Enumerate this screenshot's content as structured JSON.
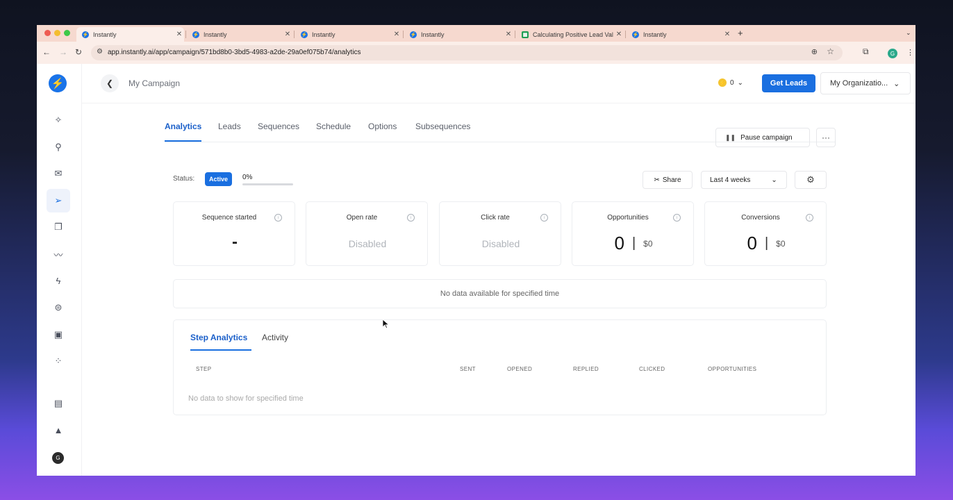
{
  "browser": {
    "tabs": [
      {
        "title": "Instantly",
        "favicon": "instantly-icon",
        "active": true
      },
      {
        "title": "Instantly",
        "favicon": "instantly-icon",
        "active": false
      },
      {
        "title": "Instantly",
        "favicon": "instantly-icon",
        "active": false
      },
      {
        "title": "Instantly",
        "favicon": "instantly-icon",
        "active": false
      },
      {
        "title": "Calculating Positive Lead Val",
        "favicon": "sheets-icon",
        "active": false
      },
      {
        "title": "Instantly",
        "favicon": "instantly-icon",
        "active": false
      }
    ],
    "new_tab": "+",
    "url": "app.instantly.ai/app/campaign/571bd8b0-3bd5-4983-a2de-29a0ef075b74/analytics",
    "profile_initial": "G"
  },
  "sidebar": {
    "items": [
      {
        "icon": "sparkle-icon"
      },
      {
        "icon": "search-icon"
      },
      {
        "icon": "mail-icon"
      },
      {
        "icon": "send-icon",
        "active": true
      },
      {
        "icon": "copy-icon"
      },
      {
        "icon": "trend-icon"
      },
      {
        "icon": "bolt-icon"
      },
      {
        "icon": "ufo-icon"
      },
      {
        "icon": "inbox-icon"
      },
      {
        "icon": "apps-icon"
      }
    ],
    "bottom": [
      {
        "icon": "feedback-icon"
      },
      {
        "icon": "rocket-icon"
      }
    ],
    "avatar_initial": "G"
  },
  "header": {
    "campaign_title": "My Campaign",
    "credits": "0",
    "get_leads": "Get Leads",
    "organization": "My Organizatio..."
  },
  "nav_tabs": [
    "Analytics",
    "Leads",
    "Sequences",
    "Schedule",
    "Options",
    "Subsequences"
  ],
  "actions": {
    "pause": "Pause campaign",
    "more": "···"
  },
  "status": {
    "label": "Status:",
    "badge": "Active",
    "progress_text": "0%",
    "progress": 0
  },
  "toolbar": {
    "share": "Share",
    "range": "Last 4 weeks"
  },
  "cards": [
    {
      "title": "Sequence started",
      "value": "-"
    },
    {
      "title": "Open rate",
      "value": "Disabled"
    },
    {
      "title": "Click rate",
      "value": "Disabled"
    },
    {
      "title": "Opportunities",
      "value": "0",
      "money": "$0"
    },
    {
      "title": "Conversions",
      "value": "0",
      "money": "$0"
    }
  ],
  "no_data": "No data available for specified time",
  "step_analytics": {
    "tabs": [
      "Step Analytics",
      "Activity"
    ],
    "columns": [
      "STEP",
      "SENT",
      "OPENED",
      "REPLIED",
      "CLICKED",
      "OPPORTUNITIES"
    ],
    "empty": "No data to show for specified time"
  }
}
